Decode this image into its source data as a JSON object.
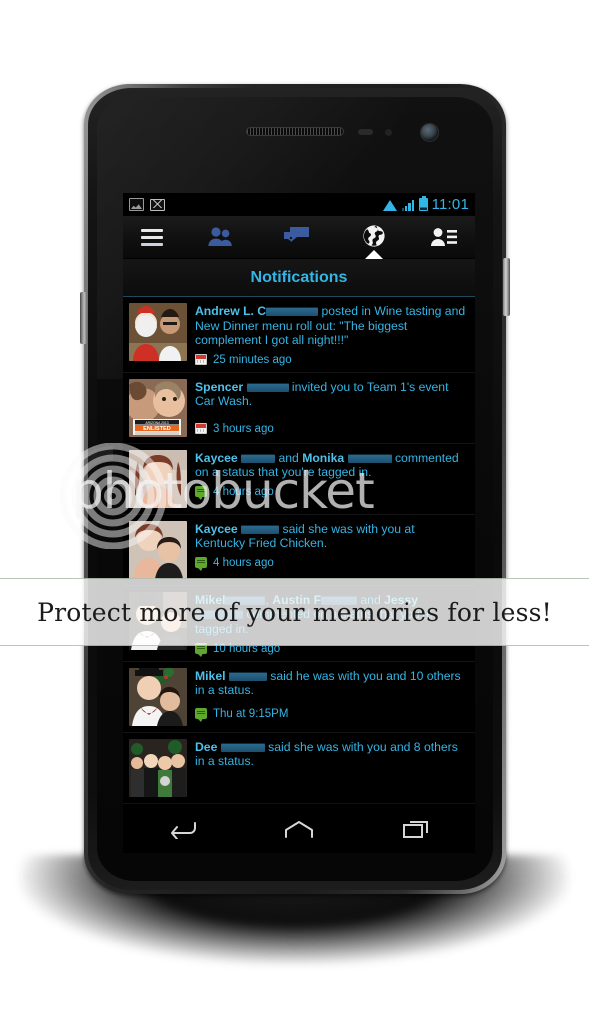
{
  "status_bar": {
    "time": "11:01",
    "left_icons": [
      "screenshot-icon",
      "gmail-icon"
    ],
    "right_icons": [
      "wifi-icon",
      "signal-icon",
      "battery-icon"
    ],
    "accent_color": "#33b5e5"
  },
  "tab_bar": {
    "items": [
      {
        "name": "menu",
        "icon": "hamburger-menu-icon",
        "active": false
      },
      {
        "name": "friends",
        "icon": "friends-icon",
        "active": false
      },
      {
        "name": "messages",
        "icon": "messages-icon",
        "active": false
      },
      {
        "name": "globe",
        "icon": "globe-icon",
        "active": true
      },
      {
        "name": "contacts",
        "icon": "contacts-list-icon",
        "active": false
      }
    ]
  },
  "header": {
    "title": "Notifications",
    "title_color": "#33b5e5"
  },
  "notifications": [
    {
      "name_prefix": "Andrew L. C",
      "redacted": true,
      "body": " posted in Wine tasting and New Dinner menu roll out: \"The biggest complement I got all night!!!\"",
      "time": "25 minutes ago",
      "icon": "calendar-icon",
      "thumb": "santa-and-man-photo"
    },
    {
      "name_prefix": "Spencer",
      "redacted": true,
      "body": " invited you to Team 1's event Car Wash.",
      "time": "3 hours ago",
      "icon": "calendar-icon",
      "thumb": "enlisted-race-bib-photo"
    },
    {
      "name_prefix": "Kaycee",
      "redacted": true,
      "body": " and Monika ███ commented on a status that you're tagged in.",
      "time": "4 hours ago",
      "icon": "comment-icon",
      "thumb": "woman-portrait-photo"
    },
    {
      "name_prefix": "Kaycee",
      "redacted": true,
      "body": " said she was with you at Kentucky Fried Chicken.",
      "time": "4 hours ago",
      "icon": "comment-icon",
      "thumb": "couple-photo"
    },
    {
      "name_prefix": "Mikel",
      "redacted": true,
      "body": ", Austin F███ and Jessy ███ commented on a status that you're tagged in.",
      "time": "10 hours ago",
      "icon": "comment-icon",
      "thumb": "costume-couple-photo"
    },
    {
      "name_prefix": "Mikel",
      "redacted": true,
      "body": " said he was with you and 10 others in a status.",
      "time": "Thu at 9:15PM",
      "icon": "comment-icon",
      "thumb": "top-hat-couple-photo"
    },
    {
      "name_prefix": "Dee",
      "redacted": true,
      "body": " said she was with you and 8 others in a status.",
      "time": "",
      "icon": "",
      "thumb": "group-photo"
    }
  ],
  "nav_bar": {
    "buttons": [
      {
        "name": "back",
        "icon": "back-arrow-icon"
      },
      {
        "name": "home",
        "icon": "home-icon"
      },
      {
        "name": "recents",
        "icon": "recent-apps-icon"
      }
    ]
  },
  "watermark": {
    "wordmark": "photobucket",
    "banner_text": "Protect more of your memories for less!",
    "logo": "photobucket-spiral-logo"
  }
}
